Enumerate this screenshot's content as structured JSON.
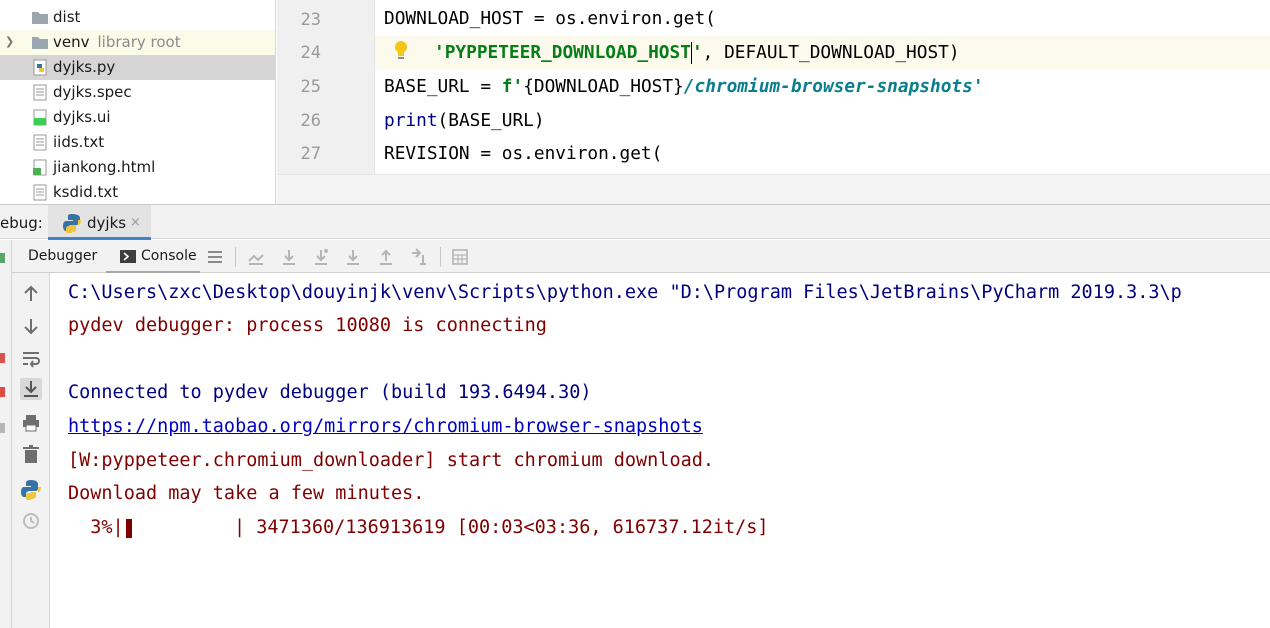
{
  "project_tree": {
    "items": [
      {
        "label": "dist",
        "sub": "",
        "icon": "folder-icon"
      },
      {
        "label": "venv",
        "sub": "library root",
        "icon": "folder-icon"
      },
      {
        "label": "dyjks.py",
        "sub": "",
        "icon": "python-file-icon"
      },
      {
        "label": "dyjks.spec",
        "sub": "",
        "icon": "text-file-icon"
      },
      {
        "label": "dyjks.ui",
        "sub": "",
        "icon": "qt-file-icon"
      },
      {
        "label": "iids.txt",
        "sub": "",
        "icon": "text-file-icon"
      },
      {
        "label": "jiankong.html",
        "sub": "",
        "icon": "html-file-icon"
      },
      {
        "label": "ksdid.txt",
        "sub": "",
        "icon": "text-file-icon"
      }
    ]
  },
  "editor": {
    "line_numbers": [
      "23",
      "24",
      "25",
      "26",
      "27"
    ],
    "lines": {
      "l23": {
        "text": "DOWNLOAD_HOST = os.environ.get("
      },
      "l24": {
        "str_a": "'PYPPETEER_DOWNLOAD_HOST",
        "str_b": "'",
        "rest": ", DEFAULT_DOWNLOAD_HOST)"
      },
      "l25": {
        "pre": "BASE_URL = ",
        "fstr_a": "f'",
        "fvar": "{DOWNLOAD_HOST}",
        "fstr_b": "/chromium-browser-snapshots'"
      },
      "l26": {
        "kw": "print",
        "rest": "(BASE_URL)"
      },
      "l27": {
        "text": "REVISION = os.environ.get("
      }
    }
  },
  "debug_window": {
    "title": "ebug:",
    "tab_label": "dyjks",
    "tab_close": "×"
  },
  "toolbar": {
    "debugger_tab": "Debugger",
    "console_tab": "Console"
  },
  "console": {
    "lines": [
      "C:\\Users\\zxc\\Desktop\\douyinjk\\venv\\Scripts\\python.exe \"D:\\Program Files\\JetBrains\\PyCharm 2019.3.3\\p",
      "pydev debugger: process 10080 is connecting",
      "Connected to pydev debugger (build 193.6494.30)",
      "https://npm.taobao.org/mirrors/chromium-browser-snapshots",
      "[W:pyppeteer.chromium_downloader] start chromium download.",
      "Download may take a few minutes."
    ],
    "progress": {
      "percent_text": "  3%|",
      "fraction": 0.03,
      "rest": "         | 3471360/136913619 [00:03<03:36, 616737.12it/s]"
    }
  },
  "colors": {
    "system_text": "#00007f",
    "error_text": "#7f0000",
    "link_text": "#0000c0",
    "string_green": "#067d17",
    "fstring_teal": "#0a7e8c",
    "keyword_blue": "#000080",
    "selection_bg": "#d5d5d5",
    "tab_underline": "#4083c9"
  }
}
